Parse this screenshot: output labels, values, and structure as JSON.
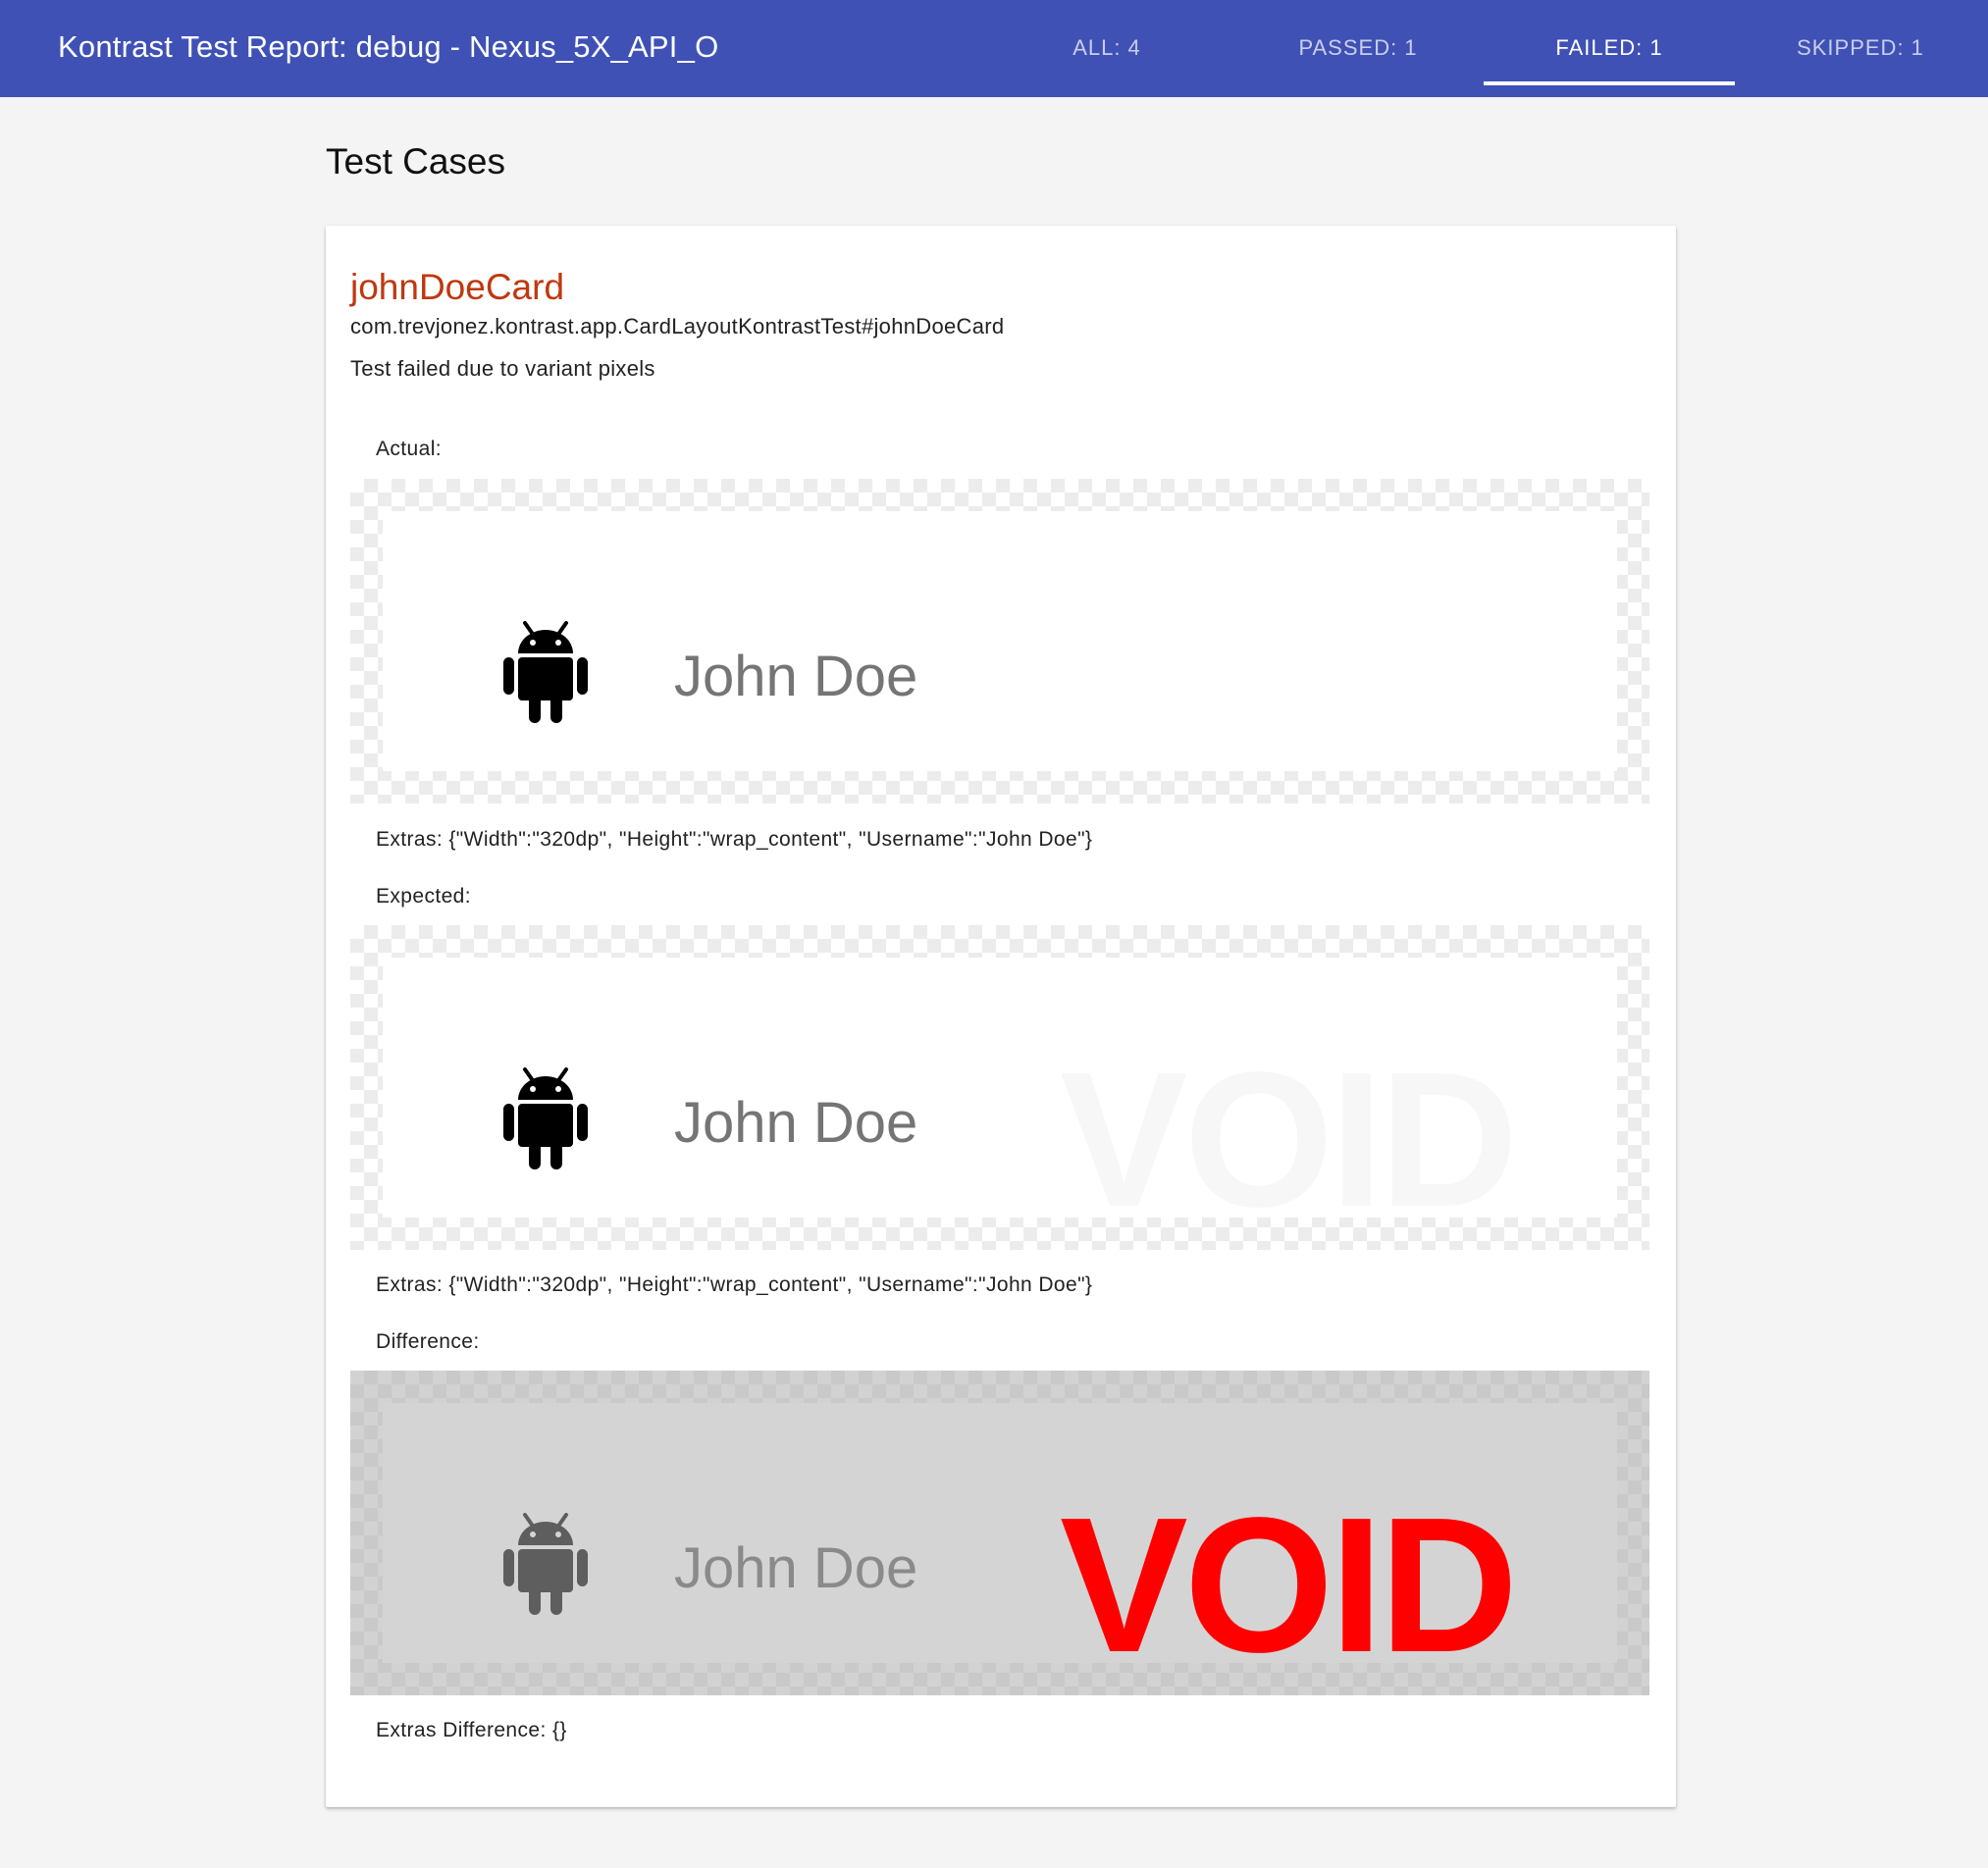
{
  "header": {
    "title": "Kontrast Test Report: debug - Nexus_5X_API_O",
    "tabs": [
      {
        "label": "ALL: 4"
      },
      {
        "label": "PASSED: 1"
      },
      {
        "label": "FAILED: 1"
      },
      {
        "label": "SKIPPED: 1"
      }
    ],
    "active_tab": "FAILED: 1"
  },
  "main": {
    "section_title": "Test Cases",
    "test_case": {
      "name": "johnDoeCard",
      "id": "com.trevjonez.kontrast.app.CardLayoutKontrastTest#johnDoeCard",
      "status": "Test failed due to variant pixels",
      "actual": {
        "label": "Actual:",
        "username": "John Doe",
        "extras": "Extras: {\"Width\":\"320dp\", \"Height\":\"wrap_content\", \"Username\":\"John Doe\"}"
      },
      "expected": {
        "label": "Expected:",
        "username": "John Doe",
        "watermark": "VOID",
        "extras": "Extras: {\"Width\":\"320dp\", \"Height\":\"wrap_content\", \"Username\":\"John Doe\"}"
      },
      "difference": {
        "label": "Difference:",
        "username": "John Doe",
        "watermark": "VOID",
        "extras": "Extras Difference: {}"
      }
    }
  },
  "colors": {
    "app_bar": "#3f51b5",
    "failed_name": "#c0370e",
    "diff_highlight": "#ff0000"
  },
  "icons": [
    "android-robot-icon"
  ]
}
